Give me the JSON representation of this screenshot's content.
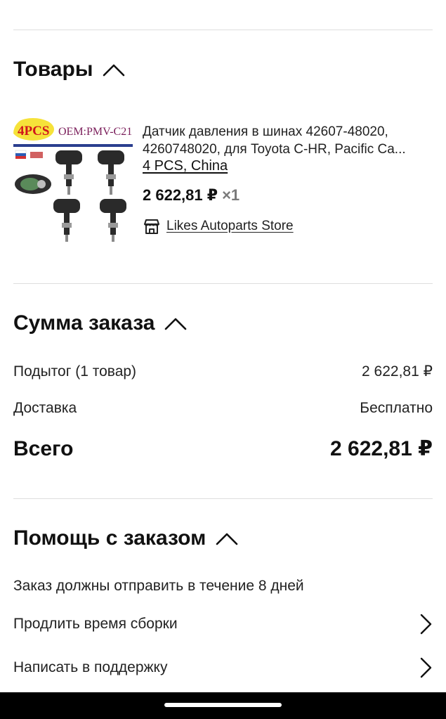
{
  "products_section": {
    "title": "Товары",
    "item": {
      "image_badge": "4PCS",
      "image_oem": "OEM:PMV-C21",
      "title_line1": "Датчик давления в шинах 42607-48020,",
      "title_line2": "4260748020, для Toyota C-HR, Pacific Ca...",
      "variant": "4 PCS, China",
      "price": "2 622,81 ₽",
      "quantity": "×1",
      "store": "Likes Autoparts Store",
      "store_icon": "store-icon"
    }
  },
  "summary_section": {
    "title": "Сумма заказа",
    "subtotal_label": "Подытог (1 товар)",
    "subtotal_value": "2 622,81 ₽",
    "delivery_label": "Доставка",
    "delivery_value": "Бесплатно",
    "total_label": "Всего",
    "total_value": "2 622,81 ₽"
  },
  "help_section": {
    "title": "Помощь с заказом",
    "ship_note": "Заказ должны отправить в течение 8 дней",
    "links": [
      {
        "label": "Продлить время сборки",
        "icon": "chevron-right-icon"
      },
      {
        "label": "Написать в поддержку",
        "icon": "chevron-right-icon"
      }
    ]
  },
  "icons": {
    "section_toggle": "chevron-up-icon"
  }
}
